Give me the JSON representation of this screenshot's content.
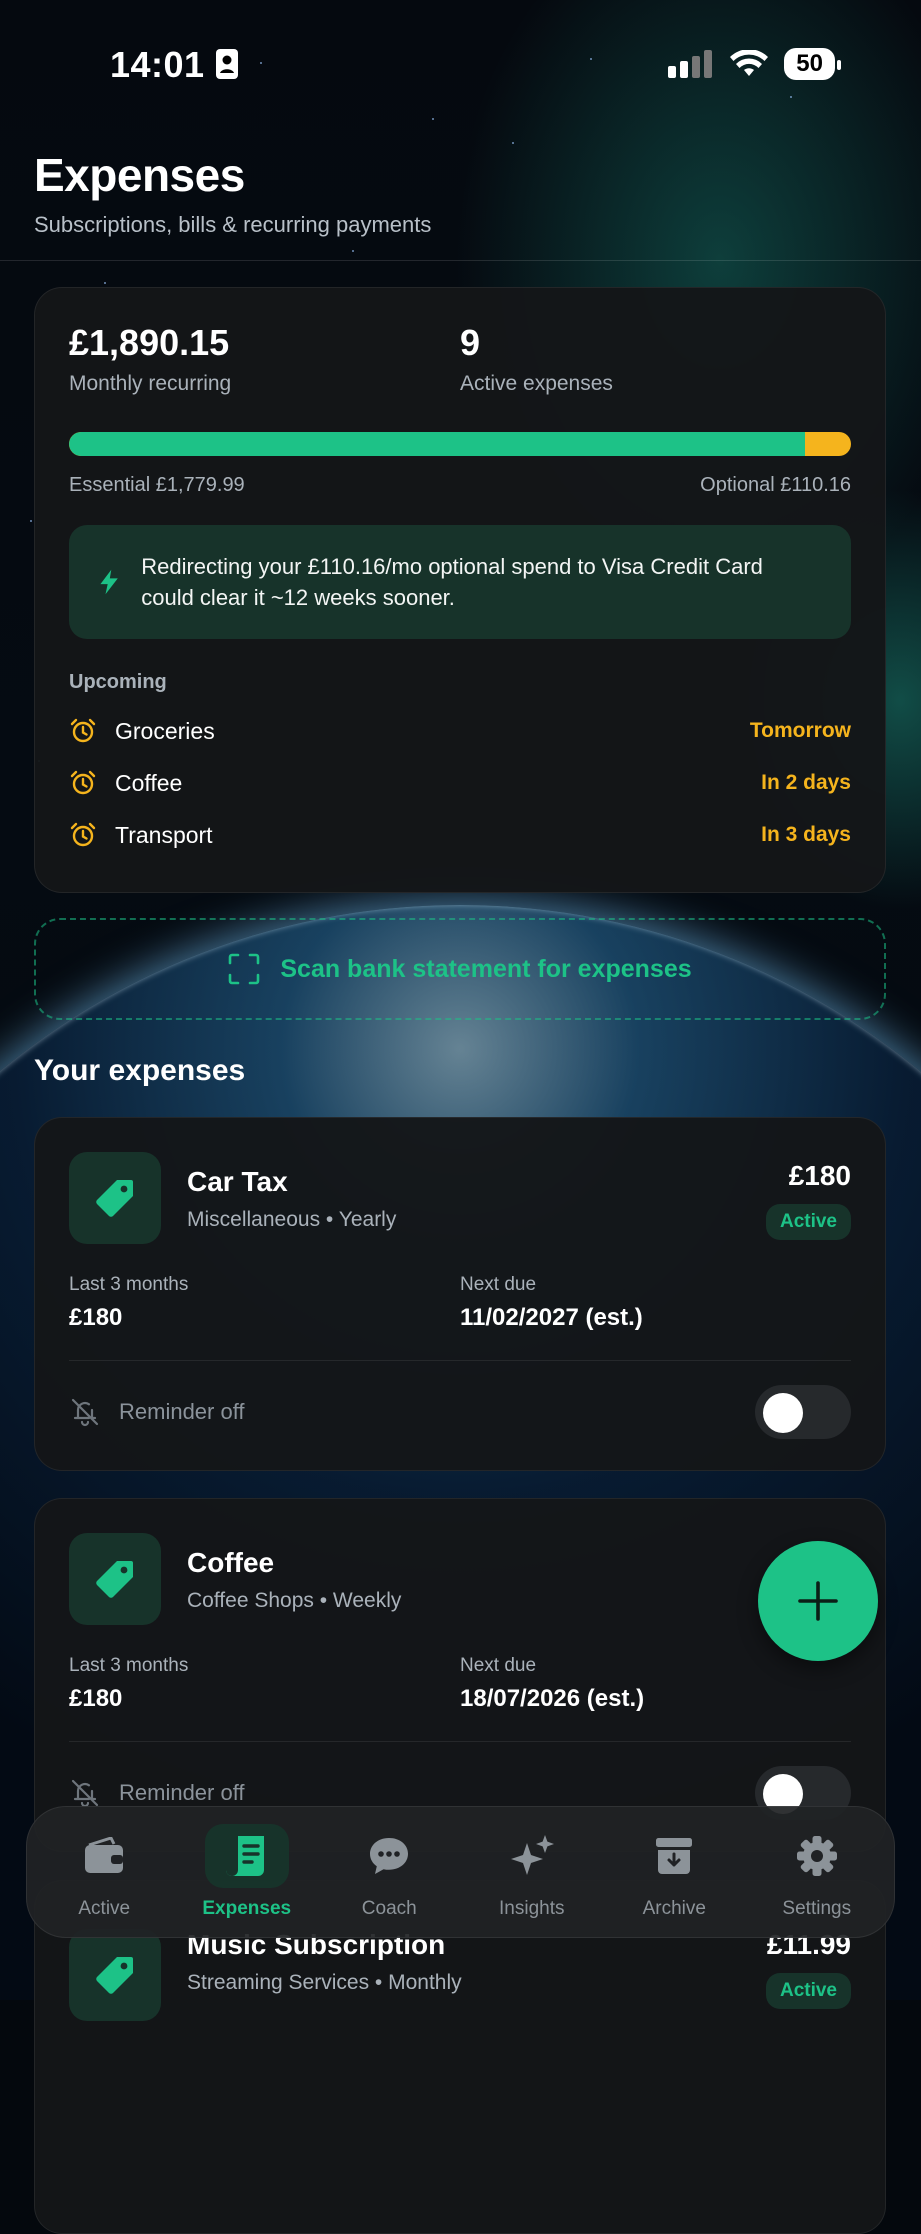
{
  "status_bar": {
    "time": "14:01",
    "battery": "50"
  },
  "header": {
    "title": "Expenses",
    "subtitle": "Subscriptions, bills & recurring payments"
  },
  "summary": {
    "monthly_amount": "£1,890.15",
    "monthly_label": "Monthly recurring",
    "active_count": "9",
    "active_label": "Active expenses",
    "essential_fraction": 0.941,
    "essential_label": "Essential £1,779.99",
    "optional_label": "Optional £110.16",
    "tip": "Redirecting your £110.16/mo optional spend to Visa Credit Card could clear it ~12 weeks sooner.",
    "upcoming_title": "Upcoming",
    "upcoming": [
      {
        "label": "Groceries",
        "when": "Tomorrow"
      },
      {
        "label": "Coffee",
        "when": "In 2 days"
      },
      {
        "label": "Transport",
        "when": "In 3 days"
      }
    ]
  },
  "scan_label": "Scan bank statement for expenses",
  "section_title": "Your expenses",
  "expenses": [
    {
      "name": "Car Tax",
      "category": "Miscellaneous",
      "frequency": "Yearly",
      "amount": "£180",
      "status": "Active",
      "last3_label": "Last 3 months",
      "last3": "£180",
      "next_label": "Next due",
      "next_due": "11/02/2027 (est.)",
      "reminder": "Reminder off"
    },
    {
      "name": "Coffee",
      "category": "Coffee Shops",
      "frequency": "Weekly",
      "last3_label": "Last 3 months",
      "last3": "£180",
      "next_label": "Next due",
      "next_due": "18/07/2026 (est.)",
      "reminder": "Reminder off"
    },
    {
      "name": "Music Subscription",
      "category": "Streaming Services",
      "frequency": "Monthly",
      "amount": "£11.99",
      "status": "Active"
    }
  ],
  "dot": "•",
  "nav": [
    {
      "label": "Active",
      "icon": "wallet-icon"
    },
    {
      "label": "Expenses",
      "icon": "receipt-icon",
      "active": true
    },
    {
      "label": "Coach",
      "icon": "chat-icon"
    },
    {
      "label": "Insights",
      "icon": "sparkles-icon"
    },
    {
      "label": "Archive",
      "icon": "archive-icon"
    },
    {
      "label": "Settings",
      "icon": "gear-icon"
    }
  ],
  "colors": {
    "accent": "#1dc287",
    "warning": "#f5b41d",
    "card": "#141618",
    "tip_bg": "#17332a"
  }
}
